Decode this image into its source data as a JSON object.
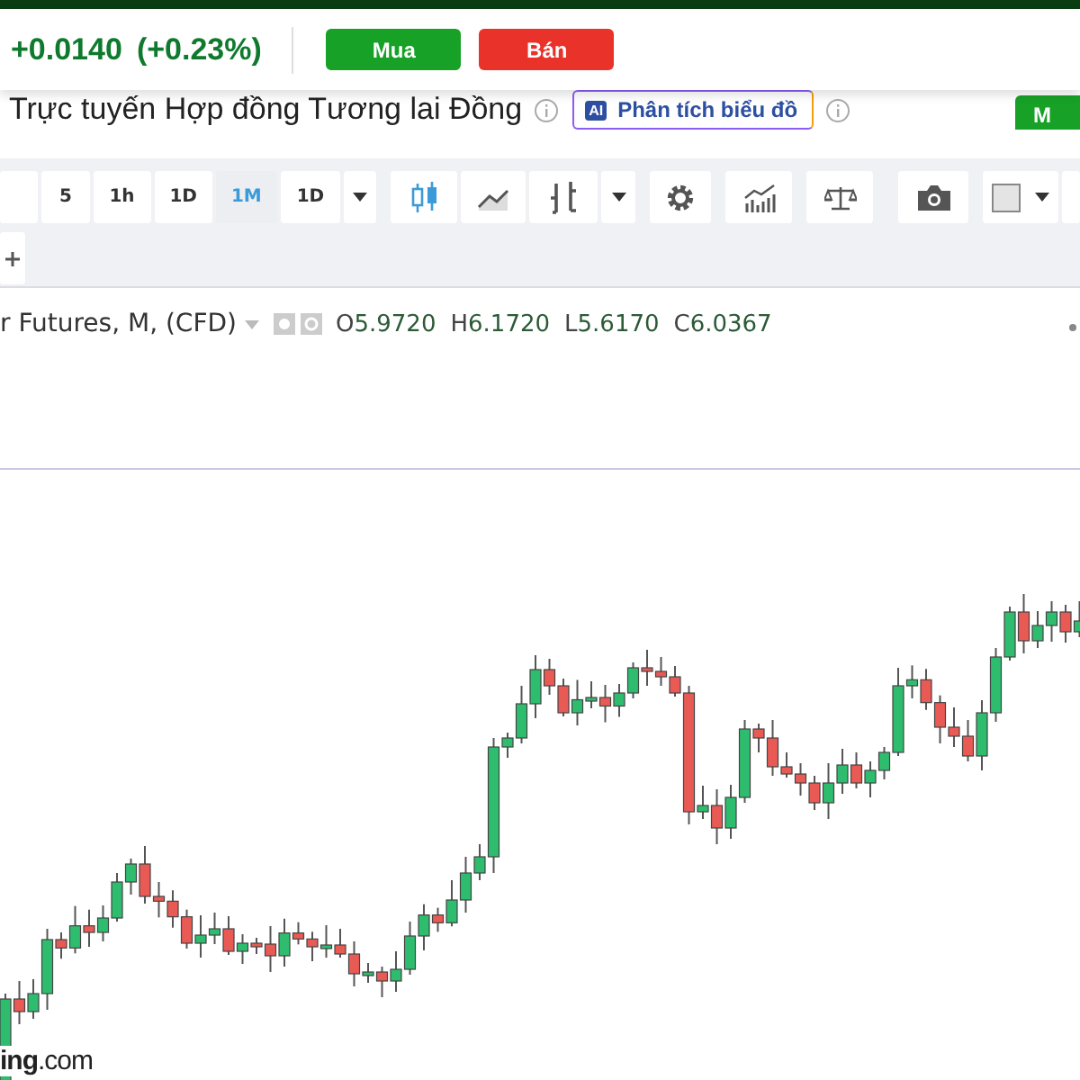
{
  "top_bar": {
    "change": "+0.0140",
    "change_percent": "(+0.23%)",
    "buttons": [
      {
        "label": "Mua",
        "kind": "buy"
      },
      {
        "label": "Bán",
        "kind": "sell"
      }
    ]
  },
  "title_row": {
    "title": "Trực tuyến Hợp đồng Tương lai Đồng",
    "ai_button": {
      "badge": "AI",
      "label": "Phân tích biểu đồ"
    },
    "side_button": "M"
  },
  "toolbar": {
    "timeframes": [
      {
        "label": "5",
        "selected": false
      },
      {
        "label": "1h",
        "selected": false
      },
      {
        "label": "1D",
        "selected": false
      },
      {
        "label": "1M",
        "selected": true
      },
      {
        "label": "1D",
        "selected": false
      }
    ],
    "chart_types": [
      {
        "kind": "candles",
        "selected": true
      },
      {
        "kind": "line",
        "selected": false
      },
      {
        "kind": "bars",
        "selected": false
      }
    ]
  },
  "legend": {
    "symbol": "r Futures, M, (CFD)",
    "values": [
      {
        "key": "O",
        "value": "5.9720"
      },
      {
        "key": "H",
        "value": "6.1720"
      },
      {
        "key": "L",
        "value": "5.6170"
      },
      {
        "key": "C",
        "value": "6.0367"
      }
    ]
  },
  "chart": {
    "logo": "**ing**.com"
  }
}
